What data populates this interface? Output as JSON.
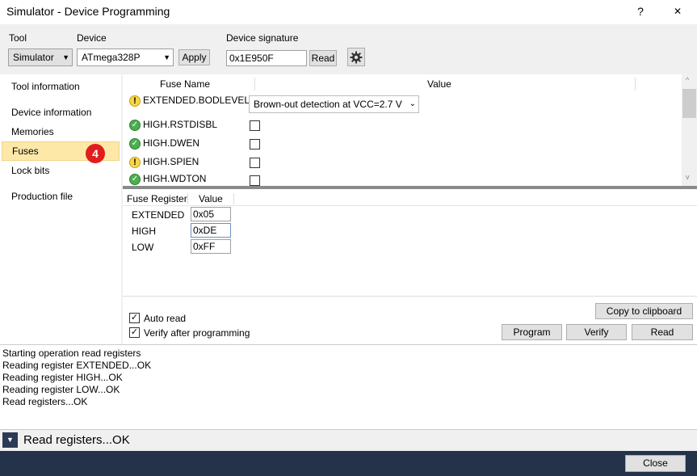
{
  "window": {
    "title": "Simulator - Device Programming",
    "help_label": "?",
    "close_glyph": "✕"
  },
  "toolbar": {
    "tool_label": "Tool",
    "tool_value": "Simulator",
    "device_label": "Device",
    "device_value": "ATmega328P",
    "apply_label": "Apply",
    "signature_label": "Device signature",
    "signature_value": "0x1E950F",
    "read_label": "Read",
    "settings_icon": "gear-icon"
  },
  "nav": {
    "items": [
      {
        "label": "Tool information"
      },
      {
        "label": "Device information"
      },
      {
        "label": "Memories"
      },
      {
        "label": "Fuses"
      },
      {
        "label": "Lock bits"
      },
      {
        "label": "Production file"
      }
    ],
    "selected": "Fuses",
    "badge": "4",
    "badge_color": "#e11d1d",
    "selected_color": "#fde8a8"
  },
  "fuses": {
    "col_name": "Fuse Name",
    "col_value": "Value",
    "rows": [
      {
        "name": "EXTENDED.BODLEVEL",
        "status": "warning",
        "value": "Brown-out detection at VCC=2.7 V"
      },
      {
        "name": "HIGH.RSTDISBL",
        "status": "ok",
        "checked": false
      },
      {
        "name": "HIGH.DWEN",
        "status": "ok",
        "checked": false
      },
      {
        "name": "HIGH.SPIEN",
        "status": "warning",
        "checked": false
      },
      {
        "name": "HIGH.WDTON",
        "status": "ok",
        "checked": false
      }
    ]
  },
  "registers": {
    "col_register": "Fuse Register",
    "col_value": "Value",
    "rows": [
      {
        "name": "EXTENDED",
        "value": "0x05"
      },
      {
        "name": "HIGH",
        "value": "0xDE"
      },
      {
        "name": "LOW",
        "value": "0xFF"
      }
    ]
  },
  "options": {
    "auto_read": "Auto read",
    "auto_read_checked": true,
    "verify": "Verify after programming",
    "verify_checked": true,
    "copy_label": "Copy to clipboard",
    "program_label": "Program",
    "verify_label": "Verify",
    "read_label": "Read"
  },
  "log": {
    "lines": [
      "Starting operation read registers",
      "Reading register EXTENDED...OK",
      "Reading register HIGH...OK",
      "Reading register LOW...OK",
      "Read registers...OK"
    ]
  },
  "status": {
    "text": "Read registers...OK",
    "close_label": "Close"
  }
}
